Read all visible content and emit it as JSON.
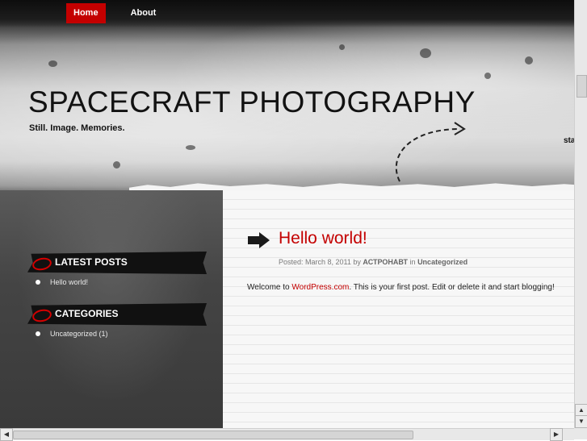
{
  "nav": {
    "items": [
      {
        "label": "Home"
      },
      {
        "label": "About"
      }
    ]
  },
  "header": {
    "title": "SPACECRAFT PHOTOGRAPHY",
    "tagline": "Still. Image. Memories.",
    "stray_text": "sta"
  },
  "sidebar": {
    "latest_posts": {
      "heading": "LATEST POSTS",
      "items": [
        "Hello world!"
      ]
    },
    "categories": {
      "heading": "CATEGORIES",
      "items": [
        "Uncategorized (1)"
      ]
    }
  },
  "post": {
    "title": "Hello world!",
    "meta_prefix": "Posted: March 8, 2011 by",
    "author": "АСТРОНАВТ",
    "meta_in": "in",
    "category": "Uncategorized",
    "body_before": "Welcome to",
    "body_link": "WordPress.com",
    "body_after": ". This is your first post. Edit or delete it and start blogging!"
  },
  "colors": {
    "accent": "#c40000"
  }
}
